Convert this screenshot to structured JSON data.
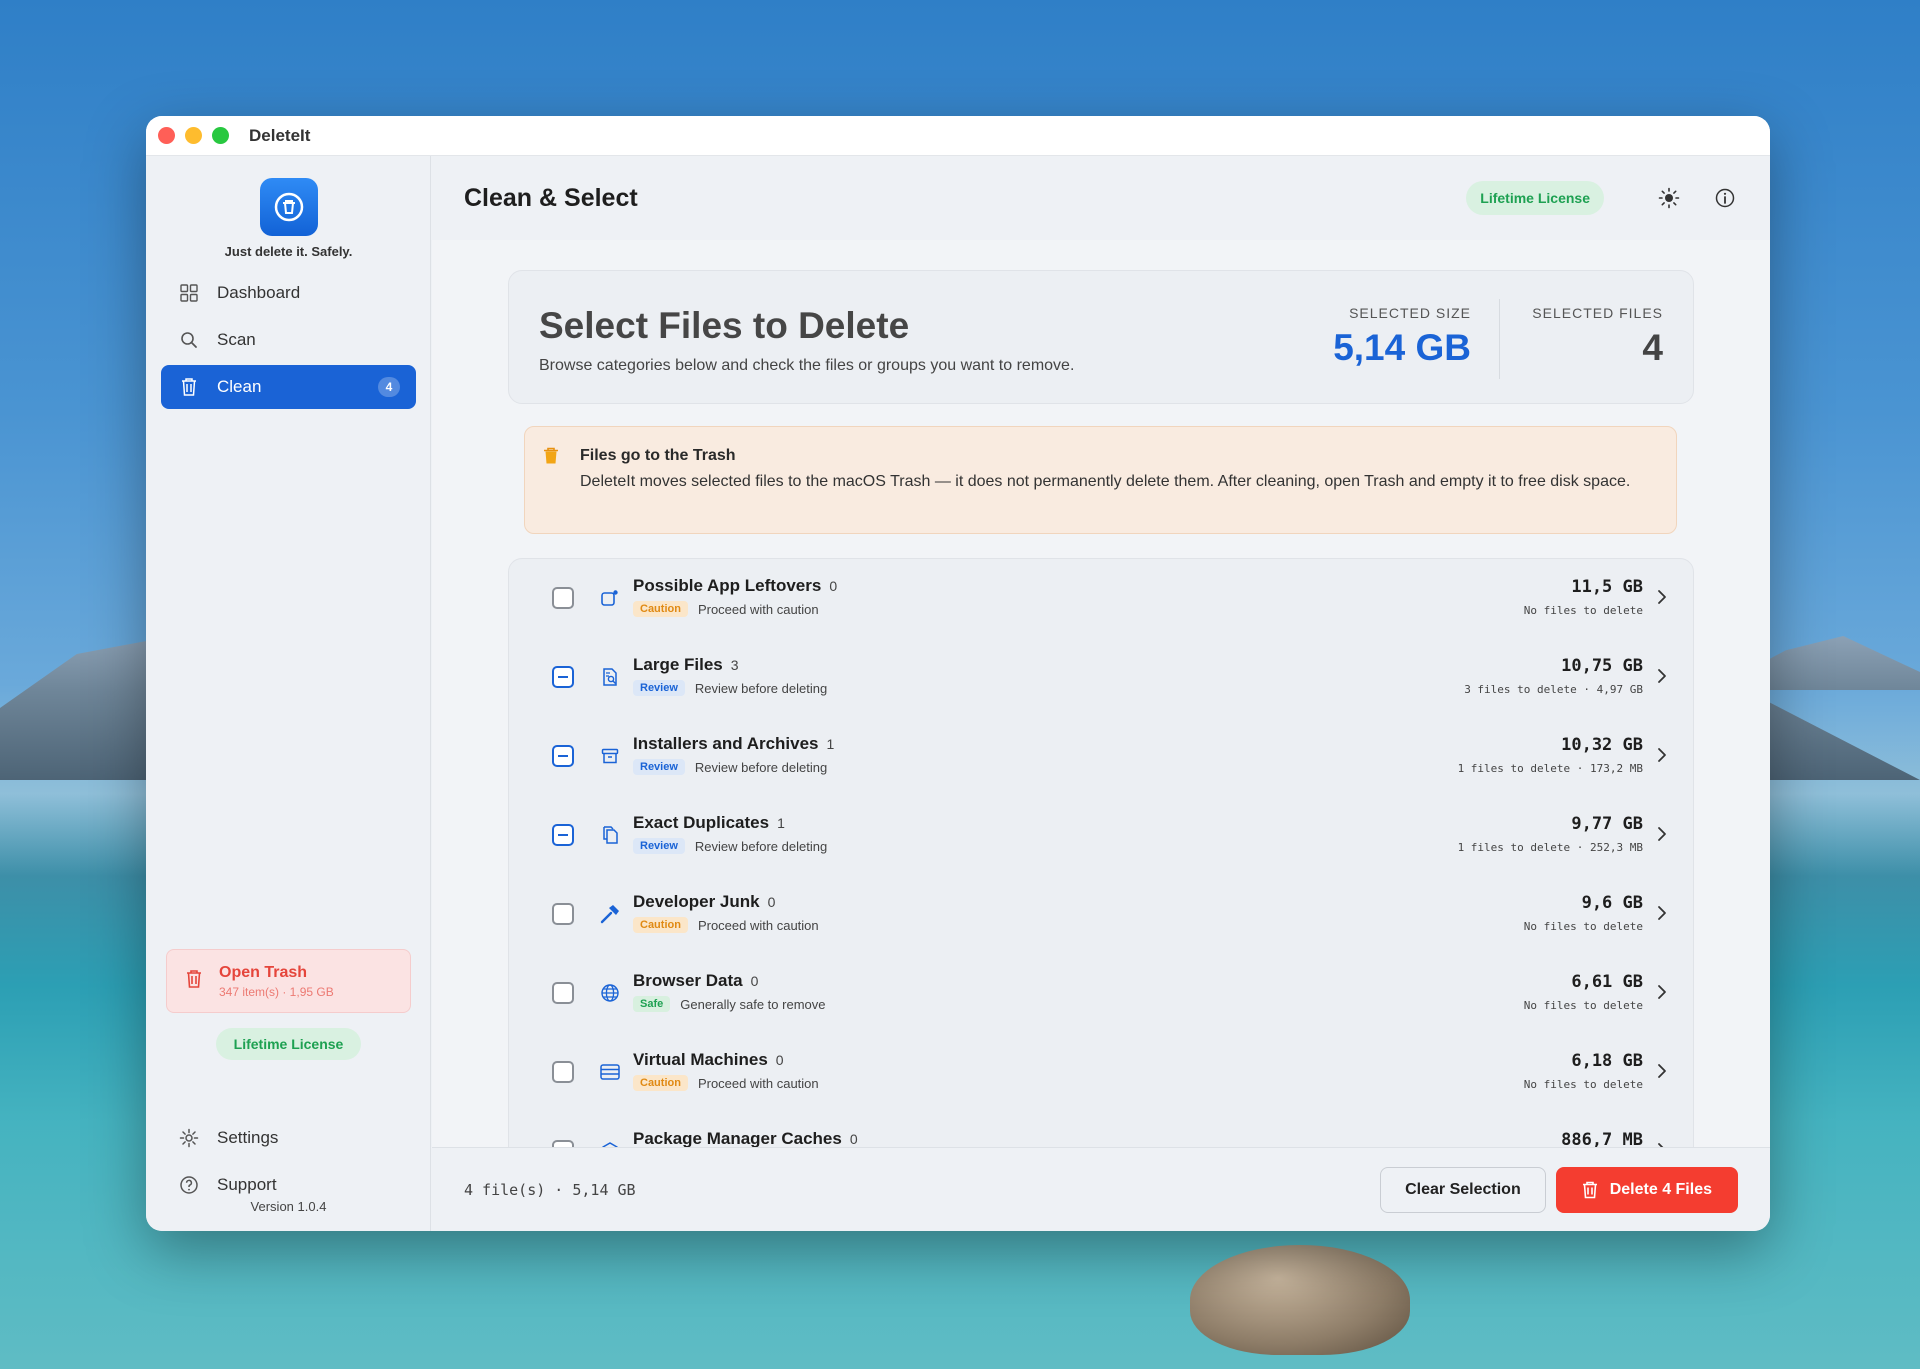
{
  "window": {
    "app_title": "DeleteIt"
  },
  "colors": {
    "accent": "#1a63d6",
    "danger": "#f43d30",
    "success": "#1ea152",
    "caution": "#e08a14"
  },
  "sidebar": {
    "tagline": "Just delete it. Safely.",
    "nav": [
      {
        "label": "Dashboard",
        "icon": "grid-icon"
      },
      {
        "label": "Scan",
        "icon": "search-icon"
      },
      {
        "label": "Clean",
        "icon": "trash-icon",
        "badge": "4",
        "active": true
      }
    ],
    "trash": {
      "title": "Open Trash",
      "subtitle": "347 item(s) · 1,95 GB"
    },
    "license": "Lifetime License",
    "settings": "Settings",
    "support": "Support",
    "version": "Version 1.0.4"
  },
  "header": {
    "title": "Clean & Select",
    "license": "Lifetime License"
  },
  "summary": {
    "title": "Select Files to Delete",
    "subtitle": "Browse categories below and check the files or groups you want to remove.",
    "size_label": "SELECTED SIZE",
    "size_value": "5,14 GB",
    "files_label": "SELECTED FILES",
    "files_value": "4"
  },
  "notice": {
    "title": "Files go to the Trash",
    "text": "DeleteIt moves selected files to the macOS Trash — it does not permanently delete them. After cleaning, open Trash and empty it to free disk space."
  },
  "categories": [
    {
      "name": "Possible App Leftovers",
      "count": "0",
      "tag": "Caution",
      "tag_kind": "caution",
      "desc": "Proceed with caution",
      "size": "11,5 GB",
      "files": "No files to delete",
      "state": "unchecked",
      "icon": "app-leftover-icon"
    },
    {
      "name": "Large Files",
      "count": "3",
      "tag": "Review",
      "tag_kind": "review",
      "desc": "Review before deleting",
      "size": "10,75 GB",
      "files": "3 files to delete · 4,97 GB",
      "state": "mixed",
      "icon": "large-file-icon"
    },
    {
      "name": "Installers and Archives",
      "count": "1",
      "tag": "Review",
      "tag_kind": "review",
      "desc": "Review before deleting",
      "size": "10,32 GB",
      "files": "1 files to delete · 173,2 MB",
      "state": "mixed",
      "icon": "archive-icon"
    },
    {
      "name": "Exact Duplicates",
      "count": "1",
      "tag": "Review",
      "tag_kind": "review",
      "desc": "Review before deleting",
      "size": "9,77 GB",
      "files": "1 files to delete · 252,3 MB",
      "state": "mixed",
      "icon": "duplicate-icon"
    },
    {
      "name": "Developer Junk",
      "count": "0",
      "tag": "Caution",
      "tag_kind": "caution",
      "desc": "Proceed with caution",
      "size": "9,6 GB",
      "files": "No files to delete",
      "state": "unchecked",
      "icon": "hammer-icon"
    },
    {
      "name": "Browser Data",
      "count": "0",
      "tag": "Safe",
      "tag_kind": "safe",
      "desc": "Generally safe to remove",
      "size": "6,61 GB",
      "files": "No files to delete",
      "state": "unchecked",
      "icon": "globe-icon"
    },
    {
      "name": "Virtual Machines",
      "count": "0",
      "tag": "Caution",
      "tag_kind": "caution",
      "desc": "Proceed with caution",
      "size": "6,18 GB",
      "files": "No files to delete",
      "state": "unchecked",
      "icon": "server-icon"
    },
    {
      "name": "Package Manager Caches",
      "count": "0",
      "tag": "",
      "tag_kind": "",
      "desc": "",
      "size": "886,7 MB",
      "files": "",
      "state": "unchecked",
      "icon": "package-icon"
    }
  ],
  "footer": {
    "summary": "4 file(s) · 5,14 GB",
    "clear": "Clear Selection",
    "delete": "Delete 4 Files"
  }
}
